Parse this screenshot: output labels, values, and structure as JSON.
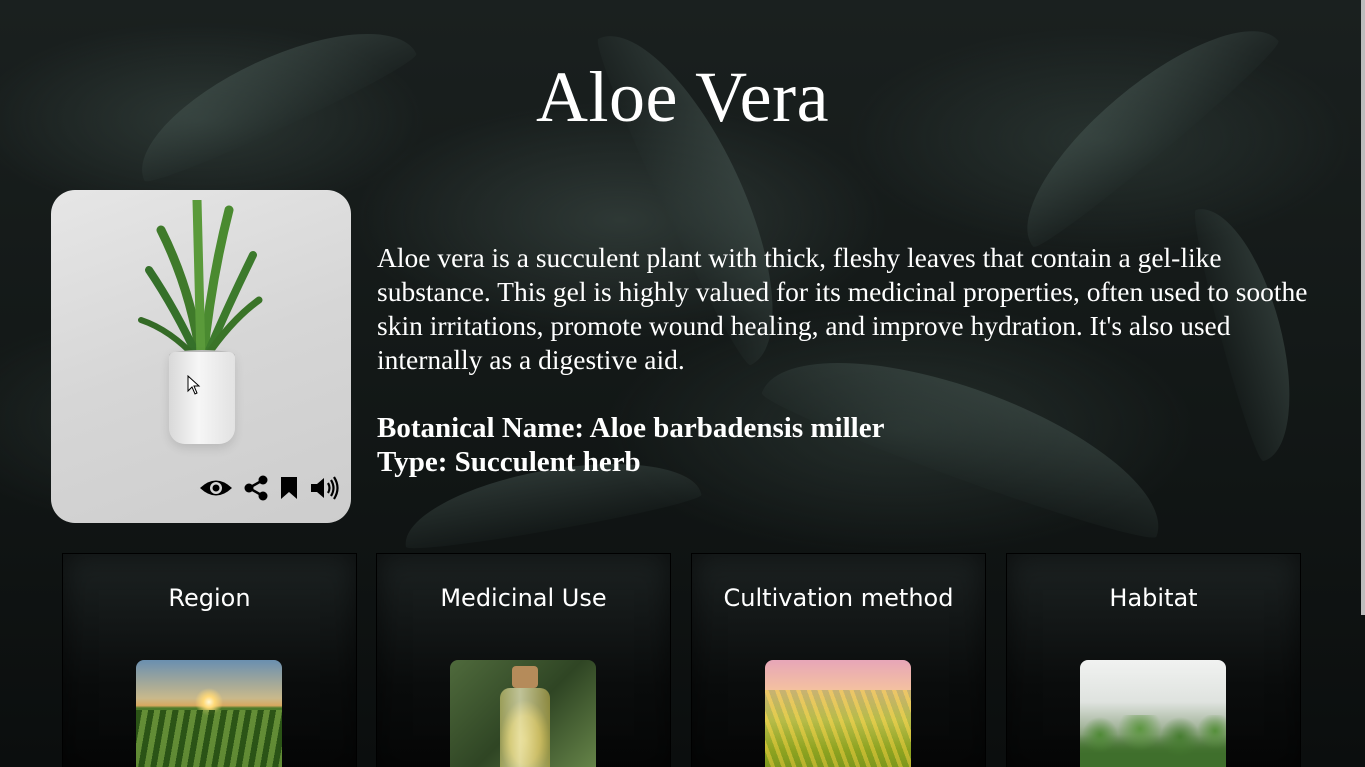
{
  "page": {
    "title": "Aloe Vera",
    "description": "Aloe vera is a succulent plant with thick, fleshy leaves that contain a gel-like substance. This gel is highly valued for its medicinal properties, often used to soothe skin irritations, promote wound healing, and improve hydration. It's also used internally as a digestive aid.",
    "botanical_name": "Botanical Name: Aloe barbadensis miller",
    "type": "Type: Succulent herb"
  },
  "plant_card": {
    "image": "aloe-vera-in-white-pot",
    "actions": [
      {
        "name": "view",
        "icon": "eye-icon"
      },
      {
        "name": "share",
        "icon": "share-icon"
      },
      {
        "name": "bookmark",
        "icon": "bookmark-icon"
      },
      {
        "name": "listen",
        "icon": "speaker-icon"
      }
    ]
  },
  "info_cards": [
    {
      "title": "Region",
      "image": "crop-field-at-sunrise"
    },
    {
      "title": "Medicinal Use",
      "image": "oil-bottle-with-herbs"
    },
    {
      "title": "Cultivation method",
      "image": "golden-rice-field"
    },
    {
      "title": "Habitat",
      "image": "misty-forest"
    }
  ],
  "colors": {
    "text": "#ffffff",
    "card_bg": "#d6d6d6",
    "page_bg": "#121716"
  }
}
